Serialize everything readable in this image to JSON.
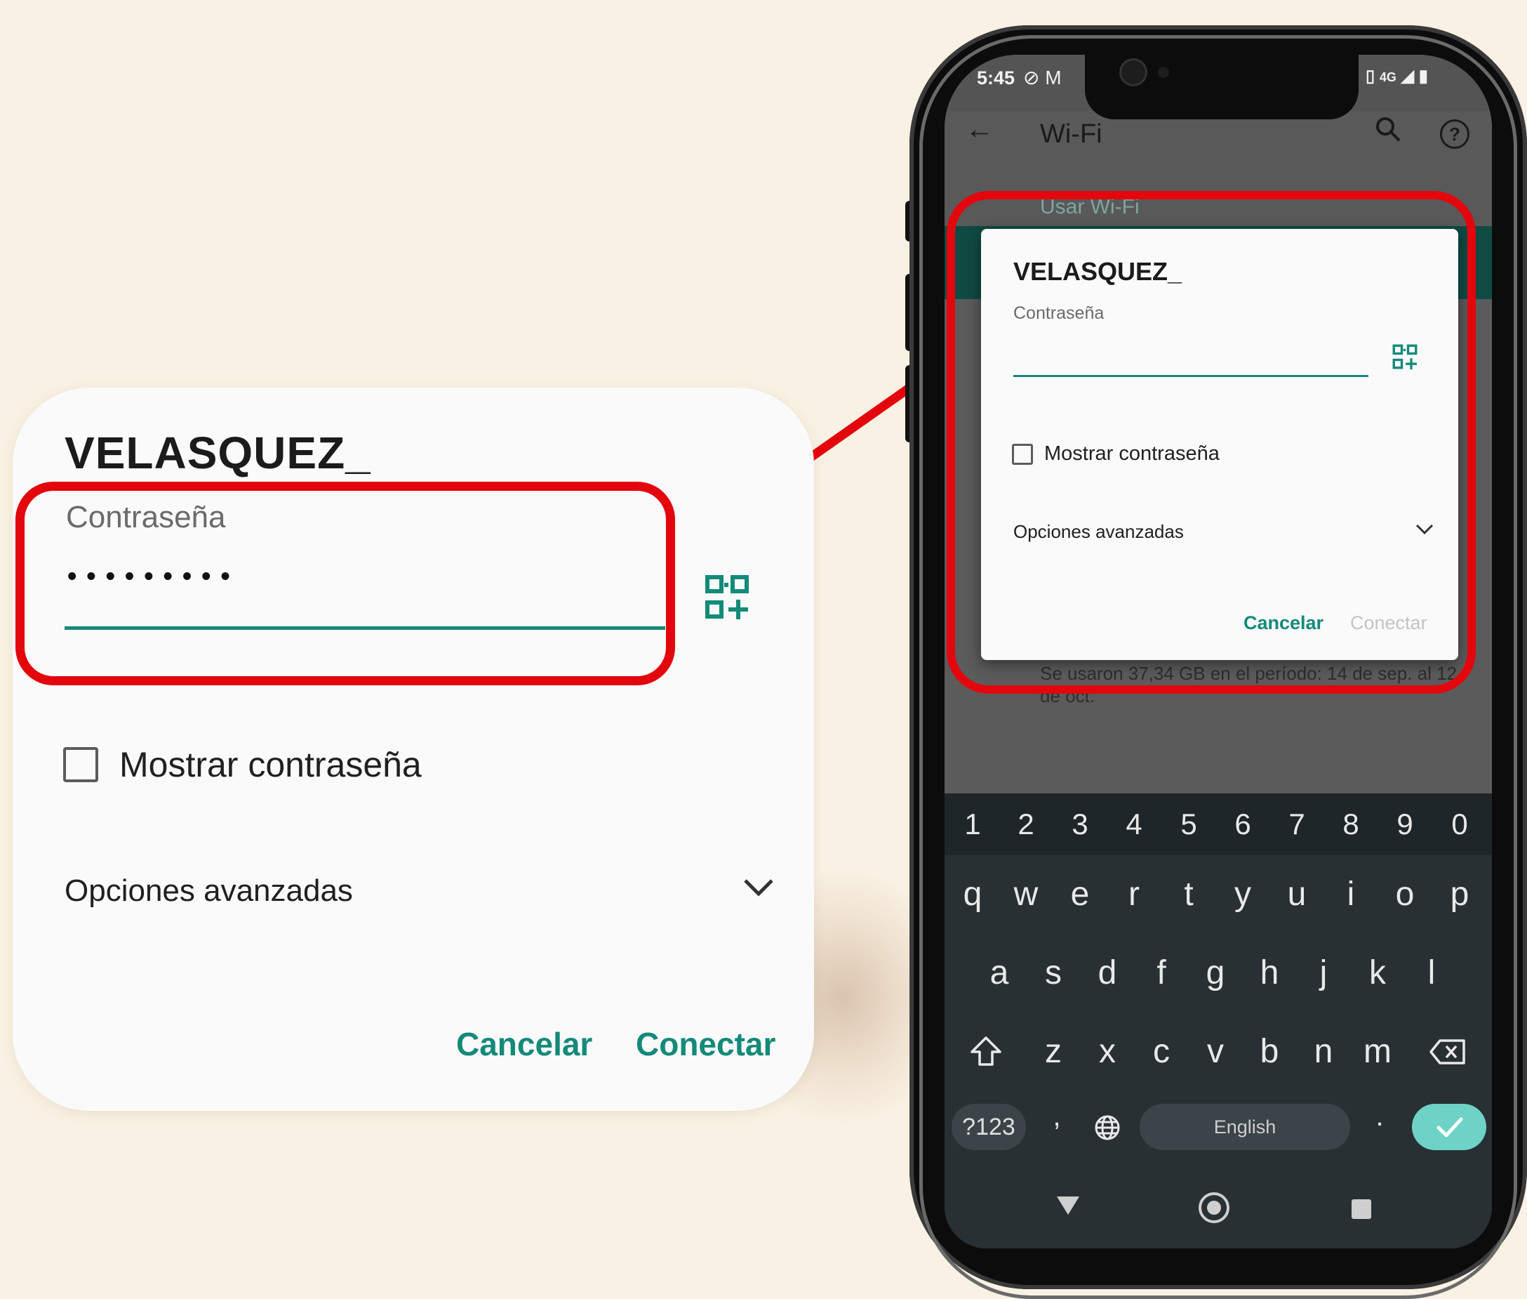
{
  "zoom_card": {
    "network_name": "VELASQUEZ_",
    "password_label": "Contraseña",
    "password_value": "•••••••••",
    "show_password_label": "Mostrar contraseña",
    "advanced_options_label": "Opciones avanzadas",
    "cancel_label": "Cancelar",
    "connect_label": "Conectar"
  },
  "status_bar": {
    "time": "5:45",
    "left_icons": "⊘ M",
    "network_type": "4G"
  },
  "app_bar": {
    "back_icon": "arrow-left-icon",
    "title": "Wi-Fi",
    "search_icon": "search-icon",
    "help_icon": "help-icon",
    "help_glyph": "?"
  },
  "background_screen": {
    "use_wifi_label": "Usar Wi-Fi",
    "usage_line1": "Se usaron 37,34 GB en el período: 14 de sep. al 12",
    "usage_line2": "de oct."
  },
  "dialog": {
    "network_name": "VELASQUEZ_",
    "password_label": "Contraseña",
    "show_password_label": "Mostrar contraseña",
    "advanced_options_label": "Opciones avanzadas",
    "cancel_label": "Cancelar",
    "connect_label": "Conectar"
  },
  "keyboard": {
    "number_row": [
      "1",
      "2",
      "3",
      "4",
      "5",
      "6",
      "7",
      "8",
      "9",
      "0"
    ],
    "row1": [
      "q",
      "w",
      "e",
      "r",
      "t",
      "y",
      "u",
      "i",
      "o",
      "p"
    ],
    "row2": [
      "a",
      "s",
      "d",
      "f",
      "g",
      "h",
      "j",
      "k",
      "l"
    ],
    "row3": [
      "z",
      "x",
      "c",
      "v",
      "b",
      "n",
      "m"
    ],
    "symbols_key": "?123",
    "comma_key": ",",
    "period_key": ".",
    "space_label": "English",
    "shift_icon": "shift-icon",
    "backspace_icon": "backspace-icon",
    "globe_icon": "globe-icon",
    "enter_icon": "check-icon"
  },
  "colors": {
    "accent": "#148a79",
    "highlight": "#e3060c",
    "background": "#f9f1e3"
  }
}
